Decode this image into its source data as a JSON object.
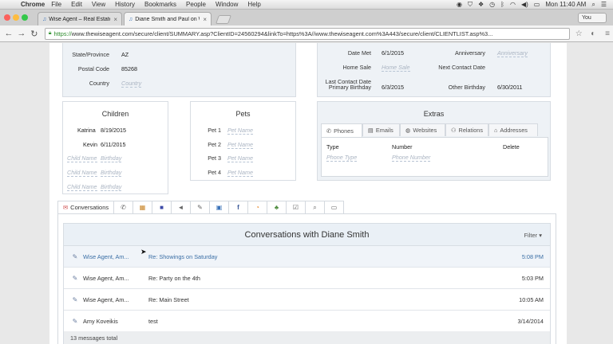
{
  "menubar": {
    "app": "Chrome",
    "items": [
      "File",
      "Edit",
      "View",
      "History",
      "Bookmarks",
      "People",
      "Window",
      "Help"
    ],
    "clock": "Mon 11:40 AM"
  },
  "browser": {
    "tabs": [
      {
        "title": "Wise Agent – Real Estate C"
      },
      {
        "title": "Diane Smith and Paul on W"
      }
    ],
    "profile": "You",
    "url_protocol": "https://",
    "url_rest": "www.thewiseagent.com/secure/client/SUMMARY.asp?ClientID=24560294&linkTo=https%3A//www.thewiseagent.com%3A443/secure/client/CLIENTLIST.asp%3..."
  },
  "address_panel": {
    "rows": [
      {
        "label": "State/Province",
        "value": "AZ",
        "placeholder": ""
      },
      {
        "label": "Postal Code",
        "value": "85268",
        "placeholder": ""
      },
      {
        "label": "Country",
        "value": "",
        "placeholder": "Country"
      }
    ]
  },
  "dates_panel": {
    "rows": [
      {
        "label": "Date Met",
        "value": "6/1/2015",
        "placeholder": ""
      },
      {
        "label": "Home Sale",
        "value": "",
        "placeholder": "Home Sale"
      },
      {
        "label": "Last Contact Date",
        "value": "",
        "placeholder": ""
      },
      {
        "label": "Primary Birthday",
        "value": "6/3/2015",
        "placeholder": ""
      }
    ],
    "rows_right": [
      {
        "label": "Anniversary",
        "value": "",
        "placeholder": "Anniversary"
      },
      {
        "label": "Next Contact Date",
        "value": "",
        "placeholder": ""
      },
      {
        "label": "Other Birthday",
        "value": "6/30/2011",
        "placeholder": ""
      }
    ]
  },
  "children": {
    "title": "Children",
    "rows": [
      {
        "name": "Katrina",
        "birthday": "8/19/2015"
      },
      {
        "name": "Kevin",
        "birthday": "6/11/2015"
      },
      {
        "name": "Child Name",
        "birthday": "Birthday",
        "empty": true
      },
      {
        "name": "Child Name",
        "birthday": "Birthday",
        "empty": true
      },
      {
        "name": "Child Name",
        "birthday": "Birthday",
        "empty": true
      }
    ]
  },
  "pets": {
    "title": "Pets",
    "rows": [
      {
        "label": "Pet 1",
        "placeholder": "Pet Name"
      },
      {
        "label": "Pet 2",
        "placeholder": "Pet Name"
      },
      {
        "label": "Pet 3",
        "placeholder": "Pet Name"
      },
      {
        "label": "Pet 4",
        "placeholder": "Pet Name"
      }
    ]
  },
  "extras": {
    "title": "Extras",
    "tabs": [
      "Phones",
      "Emails",
      "Websites",
      "Relations",
      "Addresses"
    ],
    "columns": [
      "Type",
      "Number",
      "Delete"
    ],
    "placeholders": [
      "Phone Type",
      "Phone Number"
    ]
  },
  "tabs": {
    "first_label": "Conversations",
    "icons": [
      "phone-icon",
      "calendar-icon",
      "square-icon",
      "megaphone-icon",
      "note-icon",
      "box-icon",
      "facebook-icon",
      "rss-icon",
      "sitemap-icon",
      "checklist-icon",
      "search-icon",
      "save-icon"
    ]
  },
  "conversations": {
    "title": "Conversations with Diane Smith",
    "filter": "Filter",
    "rows": [
      {
        "from": "Wise Agent, Am...",
        "subject": "Re: Showings on Saturday",
        "date": "5:08 PM",
        "selected": true
      },
      {
        "from": "Wise Agent, Am...",
        "subject": "Re: Party on the 4th",
        "date": "5:03 PM",
        "selected": false
      },
      {
        "from": "Wise Agent, Am...",
        "subject": "Re: Main Street",
        "date": "10:05 AM",
        "selected": false
      },
      {
        "from": "Amy Koveikis",
        "subject": "test",
        "date": "3/14/2014",
        "selected": false
      }
    ],
    "footer": "13 messages total"
  },
  "colors": {
    "panel_shade": "#eef2f6",
    "link_blue": "#3a6ea5",
    "placeholder": "#aab4c2"
  }
}
